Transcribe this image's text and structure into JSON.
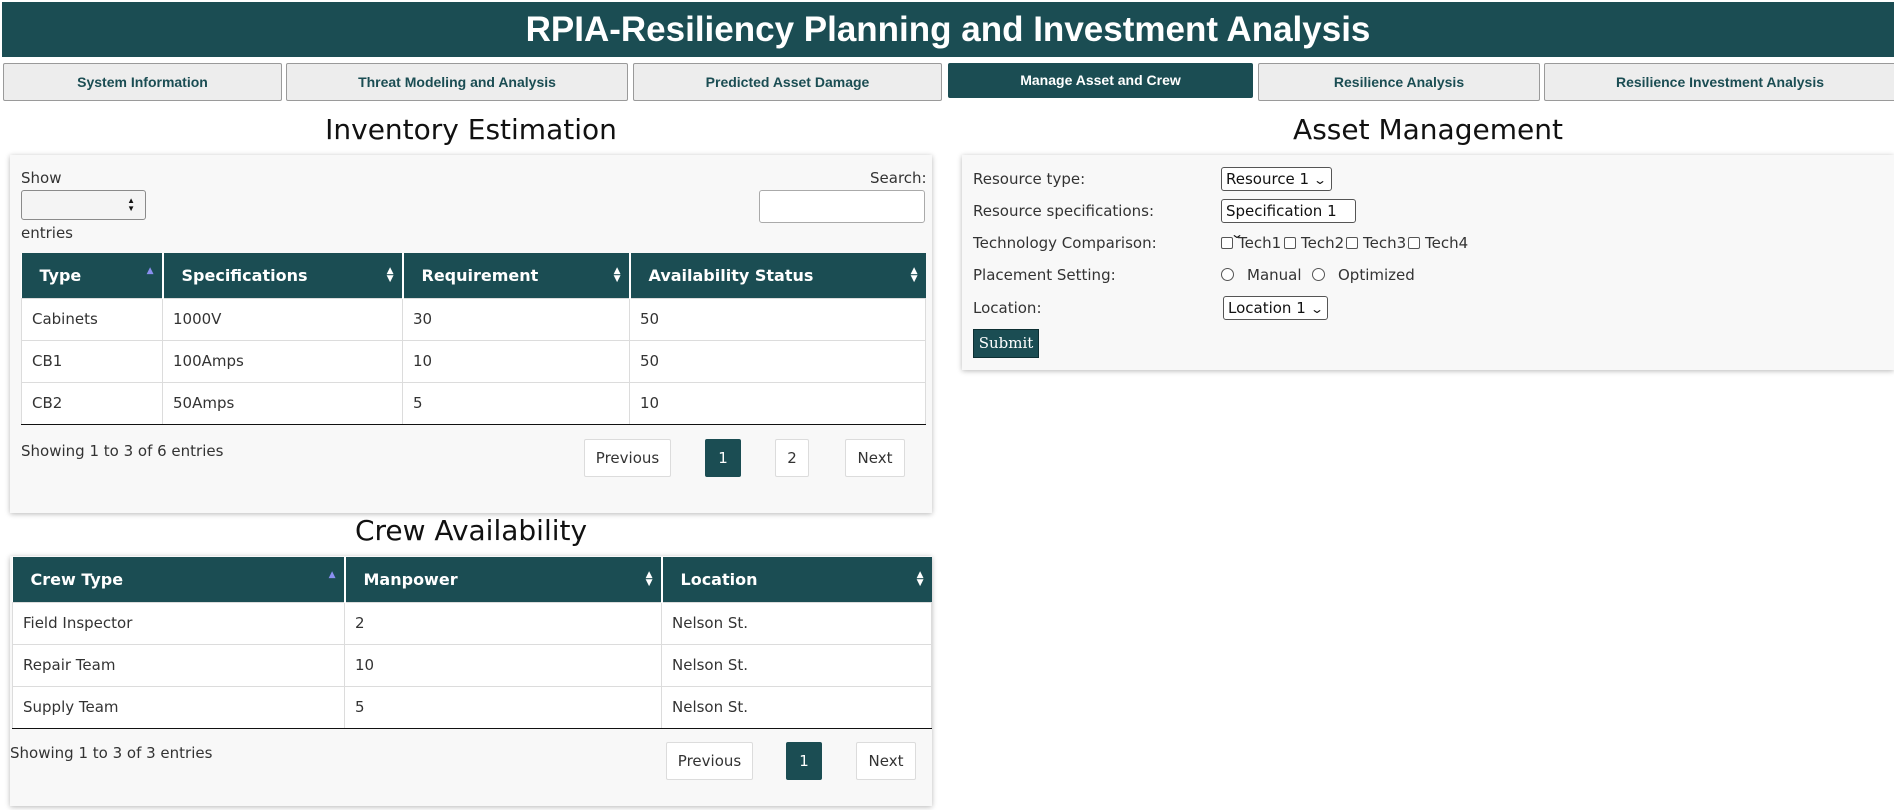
{
  "app": {
    "title": "RPIA-Resiliency Planning and Investment Analysis"
  },
  "tabs": [
    {
      "label": "System Information",
      "active": false
    },
    {
      "label": "Threat Modeling and Analysis",
      "active": false
    },
    {
      "label": "Predicted Asset Damage",
      "active": false
    },
    {
      "label": "Manage Asset and Crew",
      "active": true
    },
    {
      "label": "Resilience Analysis",
      "active": false
    },
    {
      "label": "Resilience Investment Analysis",
      "active": false
    }
  ],
  "inventory": {
    "title": "Inventory Estimation",
    "show_label": "Show",
    "show_value": "",
    "entries_label": "entries",
    "search_label": "Search:",
    "search_value": "",
    "columns": [
      "Type",
      "Specifications",
      "Requirement",
      "Availability Status"
    ],
    "rows": [
      [
        "Cabinets",
        "1000V",
        "30",
        "50"
      ],
      [
        "CB1",
        "100Amps",
        "10",
        "50"
      ],
      [
        "CB2",
        "50Amps",
        "5",
        "10"
      ]
    ],
    "info": "Showing 1 to 3 of 6 entries",
    "pagination": {
      "previous": "Previous",
      "pages": [
        "1",
        "2"
      ],
      "current": "1",
      "next": "Next"
    }
  },
  "crew": {
    "title": "Crew Availability",
    "columns": [
      "Crew Type",
      "Manpower",
      "Location"
    ],
    "rows": [
      [
        "Field Inspector",
        "2",
        "Nelson St."
      ],
      [
        "Repair Team",
        "10",
        "Nelson St."
      ],
      [
        "Supply Team",
        "5",
        "Nelson St."
      ]
    ],
    "info": "Showing 1 to 3 of 3 entries",
    "pagination": {
      "previous": "Previous",
      "pages": [
        "1"
      ],
      "current": "1",
      "next": "Next"
    }
  },
  "asset": {
    "title": "Asset Management",
    "resource_type": {
      "label": "Resource type:",
      "value": "Resource 1"
    },
    "resource_spec": {
      "label": "Resource specifications:",
      "value": "Specification 1"
    },
    "tech_comparison": {
      "label": "Technology Comparison:",
      "options": [
        "Tech1",
        "Tech2",
        "Tech3",
        "Tech4"
      ]
    },
    "placement": {
      "label": "Placement Setting:",
      "options": [
        "Manual",
        "Optimized"
      ]
    },
    "location": {
      "label": "Location:",
      "value": "Location 1"
    },
    "submit_label": "Submit"
  },
  "colors": {
    "primary": "#1b4d53",
    "tab_bg": "#ededed",
    "panel_bg": "#f8f8f8",
    "sort_active": "#8a8ff0"
  }
}
